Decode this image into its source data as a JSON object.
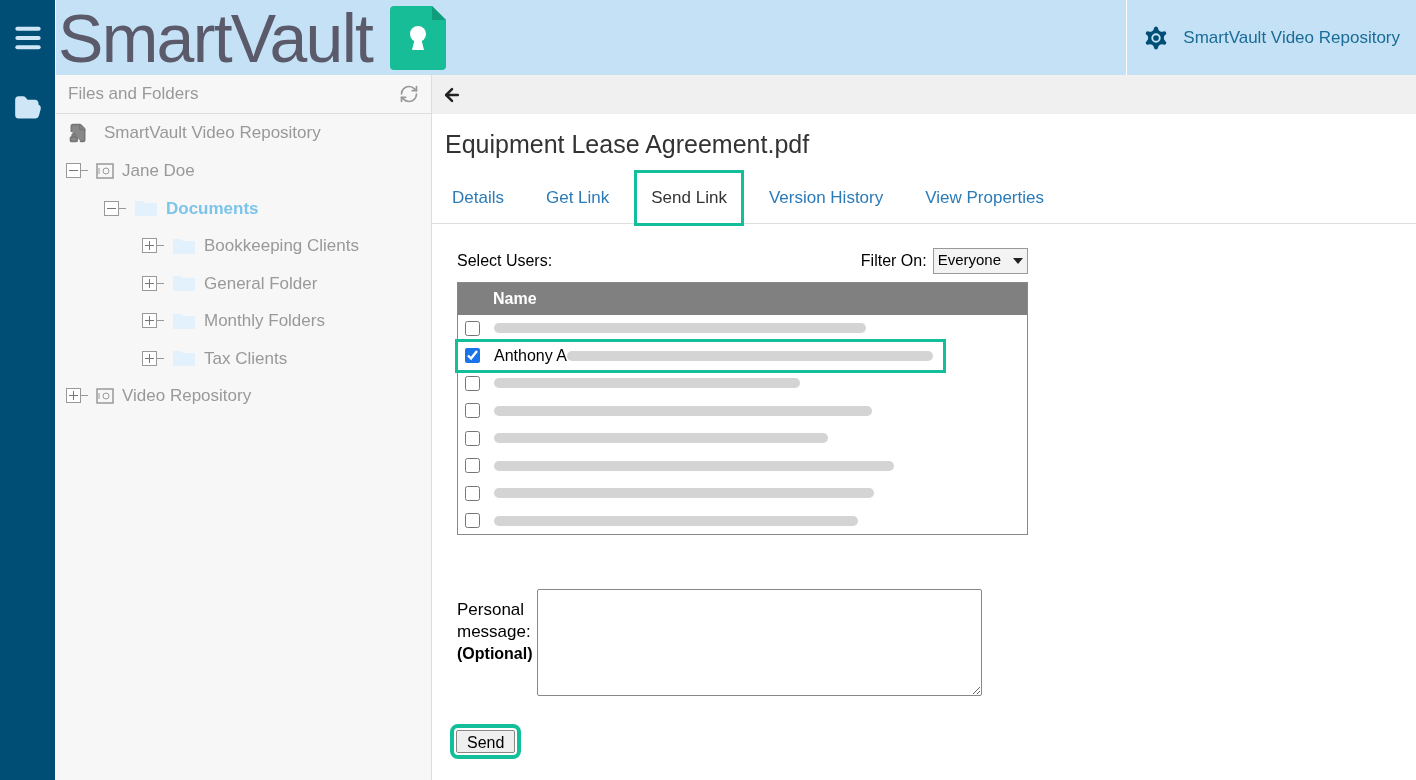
{
  "header": {
    "logo": "SmartVault",
    "repository": "SmartVault Video Repository"
  },
  "sidebar": {
    "title": "Files and Folders",
    "root": "SmartVault Video Repository",
    "tree": [
      {
        "label": "Jane Doe",
        "kind": "vault",
        "expanded": true,
        "selected": false,
        "children": [
          {
            "label": "Documents",
            "kind": "folder",
            "expanded": true,
            "selected": true,
            "children": [
              {
                "label": "Bookkeeping Clients",
                "kind": "folder",
                "expanded": false,
                "selected": false
              },
              {
                "label": "General Folder",
                "kind": "folder",
                "expanded": false,
                "selected": false
              },
              {
                "label": "Monthly Folders",
                "kind": "folder",
                "expanded": false,
                "selected": false
              },
              {
                "label": "Tax Clients",
                "kind": "folder",
                "expanded": false,
                "selected": false
              }
            ]
          }
        ]
      },
      {
        "label": "Video Repository",
        "kind": "vault",
        "expanded": false,
        "selected": false
      }
    ]
  },
  "file": {
    "title": "Equipment Lease Agreement.pdf"
  },
  "tabs": [
    {
      "label": "Details",
      "selected": false,
      "highlighted": false
    },
    {
      "label": "Get Link",
      "selected": false,
      "highlighted": false
    },
    {
      "label": "Send Link",
      "selected": true,
      "highlighted": true
    },
    {
      "label": "Version History",
      "selected": false,
      "highlighted": false
    },
    {
      "label": "View Properties",
      "selected": false,
      "highlighted": false
    }
  ],
  "select_users_label": "Select Users:",
  "filter_label": "Filter On:",
  "filter_value": "Everyone",
  "users_table": {
    "column": "Name",
    "rows": [
      {
        "checked": false,
        "highlighted": false
      },
      {
        "name": "Anthony A",
        "checked": true,
        "highlighted": true
      },
      {
        "checked": false,
        "highlighted": false
      },
      {
        "checked": false,
        "highlighted": false
      },
      {
        "checked": false,
        "highlighted": false
      },
      {
        "checked": false,
        "highlighted": false
      },
      {
        "checked": false,
        "highlighted": false
      },
      {
        "checked": false,
        "highlighted": false
      }
    ]
  },
  "message": {
    "label": "Personal message:",
    "hint": "(Optional)"
  },
  "send_button": {
    "label": "Send",
    "highlighted": true
  }
}
